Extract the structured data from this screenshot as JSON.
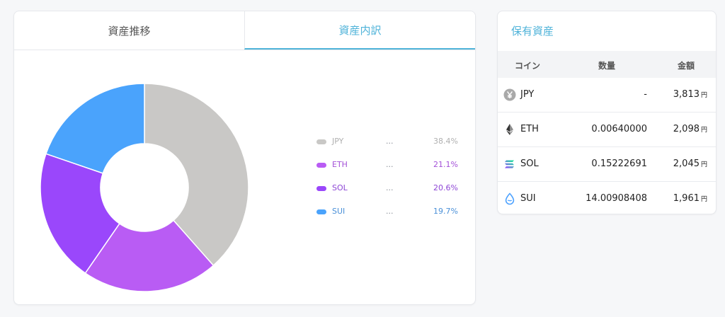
{
  "tabs": [
    {
      "label": "資産推移",
      "active": false
    },
    {
      "label": "資産内訳",
      "active": true
    }
  ],
  "chart_data": {
    "type": "pie",
    "categories": [
      "JPY",
      "ETH",
      "SOL",
      "SUI"
    ],
    "values": [
      38.4,
      21.1,
      20.6,
      19.7
    ],
    "labels": [
      "38.4%",
      "21.1%",
      "20.6%",
      "19.7%"
    ],
    "colors": [
      "#c9c8c6",
      "#b95cf4",
      "#9a47fb",
      "#4aa3fc"
    ],
    "legend_text_colors": [
      "#b0b0b0",
      "#a452d8",
      "#8e47d6",
      "#4a90d8"
    ],
    "legend_ellipsis": "...",
    "legend": "right",
    "donut": true
  },
  "holdings": {
    "title": "保有資産",
    "columns": {
      "coin": "コイン",
      "quantity": "数量",
      "amount": "金額"
    },
    "currency_unit": "円",
    "rows": [
      {
        "icon": "yen-icon",
        "coin": "JPY",
        "quantity": "-",
        "amount": "3,813"
      },
      {
        "icon": "ethereum-icon",
        "coin": "ETH",
        "quantity": "0.00640000",
        "amount": "2,098"
      },
      {
        "icon": "solana-icon",
        "coin": "SOL",
        "quantity": "0.15222691",
        "amount": "2,045"
      },
      {
        "icon": "sui-icon",
        "coin": "SUI",
        "quantity": "14.00908408",
        "amount": "1,961"
      }
    ]
  }
}
